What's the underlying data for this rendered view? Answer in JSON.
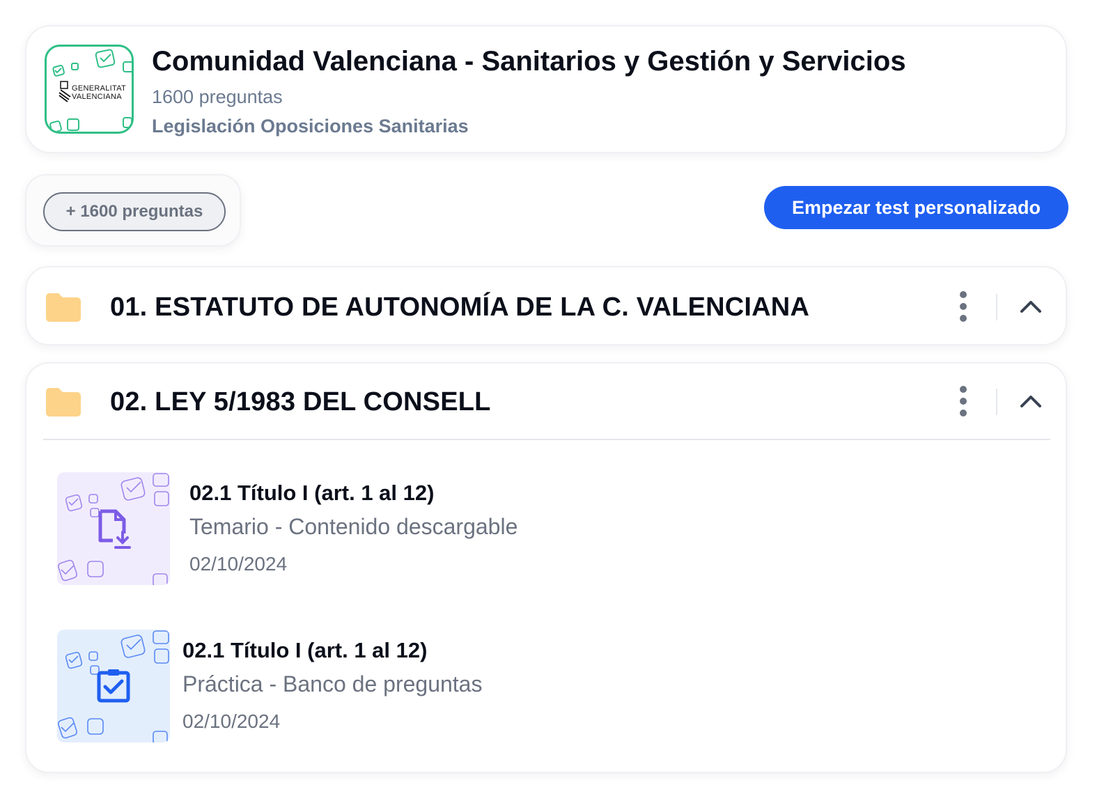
{
  "header": {
    "title": "Comunidad Valenciana - Sanitarios y Gestión y Servicios",
    "question_count": "1600 preguntas",
    "category": "Legislación Oposiciones Sanitarias",
    "logo_text_line1": "GENERALITAT",
    "logo_text_line2": "VALENCIANA"
  },
  "toolbar": {
    "chip_label": "+ 1600 preguntas",
    "start_button_label": "Empezar test personalizado"
  },
  "folders": [
    {
      "title": "01. ESTATUTO DE AUTONOMÍA DE LA C. VALENCIANA",
      "expanded": true
    },
    {
      "title": "02. LEY 5/1983 DEL CONSELL",
      "expanded": true,
      "items": [
        {
          "title": "02.1  Título I (art. 1 al 12)",
          "subtitle": "Temario - Contenido descargable",
          "date": "02/10/2024",
          "icon": "file-download-icon",
          "theme_color": "#7c5ce6",
          "theme_bg": "#f1ecfd"
        },
        {
          "title": "02.1  Título I (art. 1 al 12)",
          "subtitle": "Práctica - Banco de preguntas",
          "date": "02/10/2024",
          "icon": "clipboard-check-icon",
          "theme_color": "#1f5ff0",
          "theme_bg": "#e3eefd"
        }
      ]
    }
  ],
  "colors": {
    "accent": "#1f5ff0",
    "logo_border": "#2fbf86",
    "folder": "#fdd38a",
    "muted_text": "#6b7280"
  }
}
